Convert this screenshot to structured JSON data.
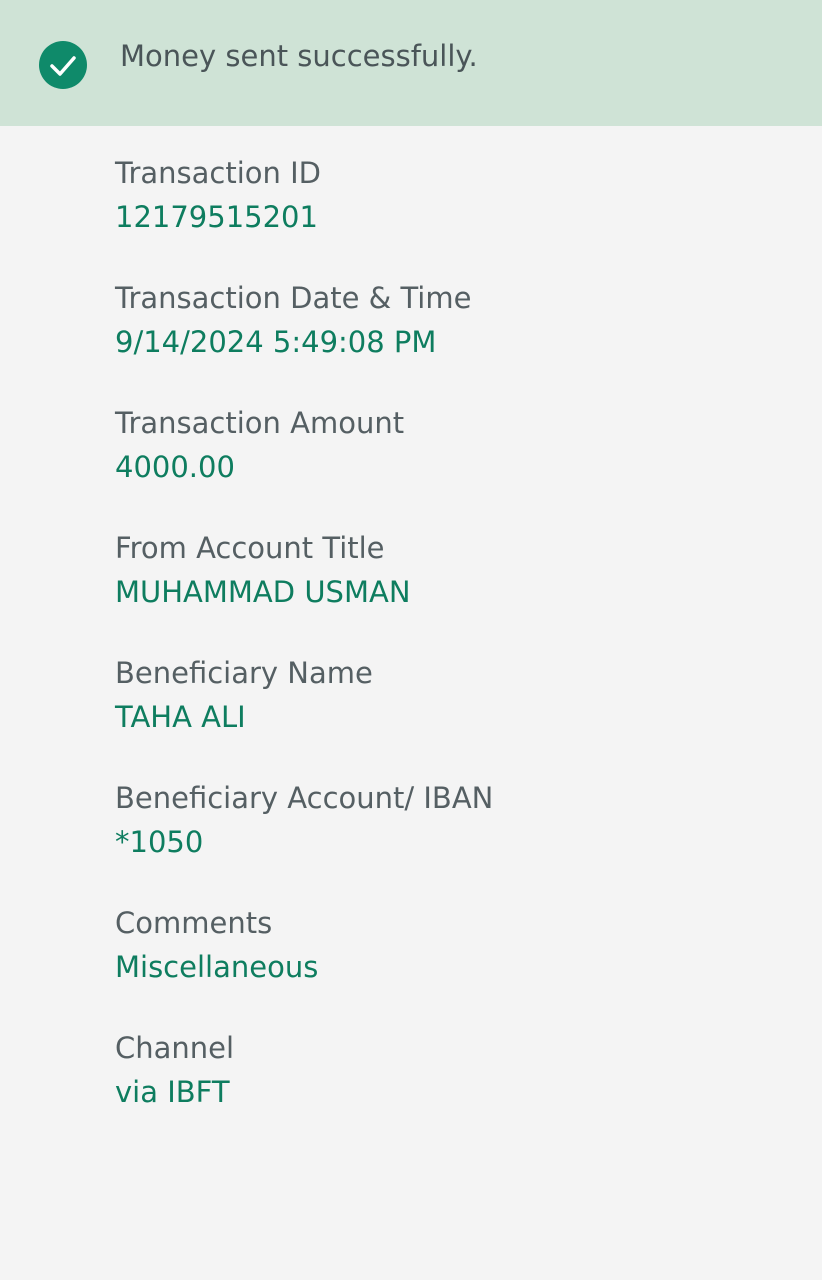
{
  "banner": {
    "icon": "check-circle-icon",
    "message": "Money sent successfully.",
    "accent_color": "#0f8a6a",
    "background_color": "#cfe3d6"
  },
  "details": [
    {
      "label": "Transaction ID",
      "value": "12179515201"
    },
    {
      "label": "Transaction Date & Time",
      "value": "9/14/2024 5:49:08 PM"
    },
    {
      "label": "Transaction Amount",
      "value": "4000.00"
    },
    {
      "label": "From Account Title",
      "value": "MUHAMMAD USMAN"
    },
    {
      "label": "Beneficiary Name",
      "value": "TAHA ALI"
    },
    {
      "label": "Beneficiary Account/ IBAN",
      "value": "*1050"
    },
    {
      "label": "Comments",
      "value": "Miscellaneous"
    },
    {
      "label": "Channel",
      "value": "via IBFT"
    }
  ]
}
